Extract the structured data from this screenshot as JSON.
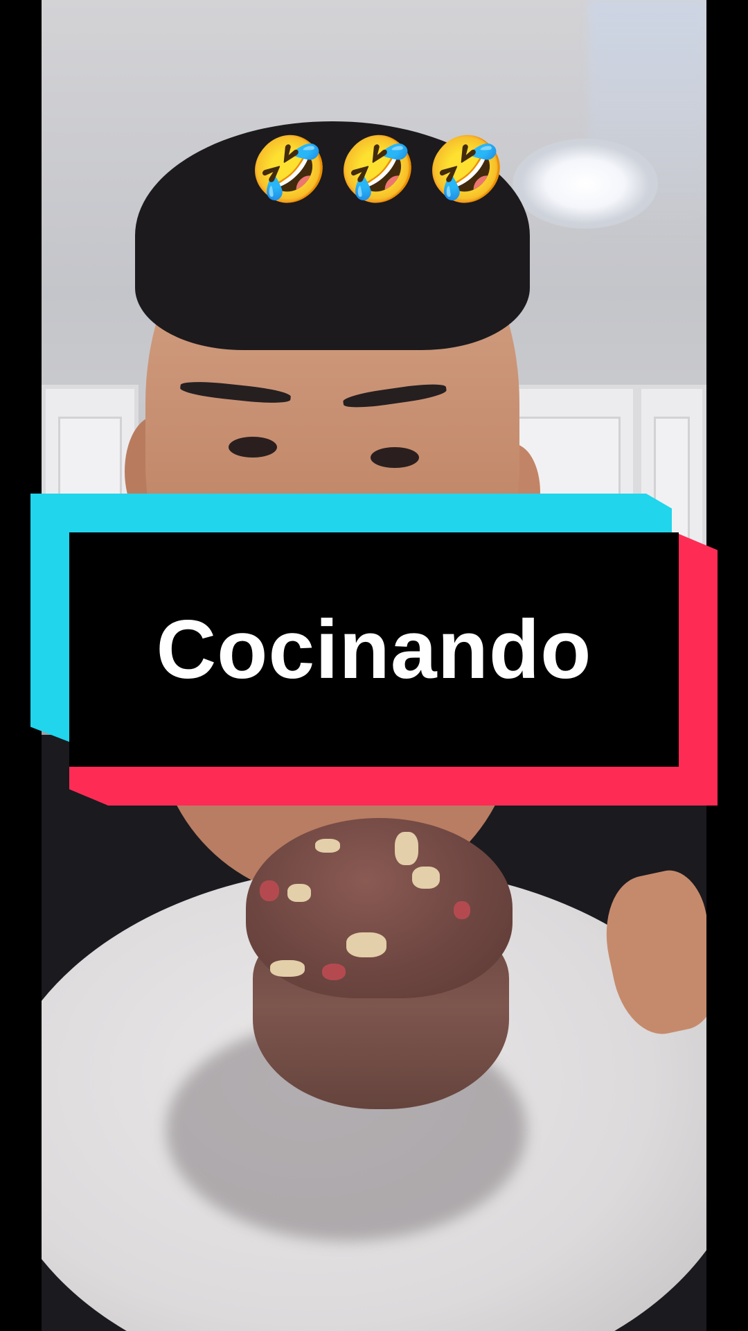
{
  "overlay": {
    "emojis": [
      "🤣",
      "🤣",
      "🤣"
    ],
    "title": "Cocinando"
  },
  "colors": {
    "title_card_bg": "#000000",
    "title_text": "#ffffff",
    "accent_cyan": "#20d5ec",
    "accent_red": "#fe2c55",
    "letterbox": "#000000"
  },
  "icons": {
    "emoji": "rolling-on-the-floor-laughing"
  }
}
